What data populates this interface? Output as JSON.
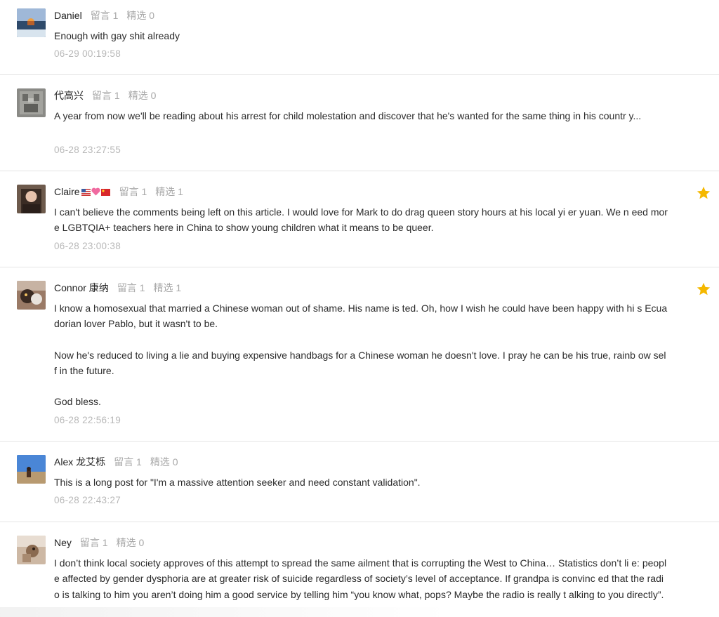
{
  "comments": [
    {
      "author": "Daniel",
      "author_flags": [],
      "reply_label": "留言 1",
      "featured_label": "精选 0",
      "paragraphs": [
        "Enough with gay shit already"
      ],
      "time": "06-29 00:19:58",
      "starred": false,
      "avatar_icon": "sea-sunset-avatar-icon"
    },
    {
      "author": "代高兴",
      "author_flags": [],
      "reply_label": "留言 1",
      "featured_label": "精选 0",
      "paragraphs": [
        "A year from now we'll be reading about his arrest for child molestation and discover that he's wanted for the same thing in his countr y..."
      ],
      "time": "06-28 23:27:55",
      "starred": false,
      "avatar_icon": "stone-carving-avatar-icon"
    },
    {
      "author": "Claire",
      "author_flags": [
        "us-flag-icon",
        "heart-icon",
        "china-flag-icon"
      ],
      "reply_label": "留言 1",
      "featured_label": "精选 1",
      "paragraphs": [
        "I can't believe the comments being left on this article. I would love for Mark to do drag queen story hours at his local yi er yuan. We n eed more LGBTQIA+ teachers here in China to show young children what it means to be queer."
      ],
      "time": "06-28 23:00:38",
      "starred": true,
      "avatar_icon": "portrait-avatar-icon"
    },
    {
      "author": "Connor 康纳",
      "author_flags": [],
      "reply_label": "留言 1",
      "featured_label": "精选 1",
      "paragraphs": [
        "I know a homosexual that married a Chinese woman out of shame. His name is ted. Oh, how I wish he could have been happy with hi s Ecuadorian lover Pablo, but it wasn't to be.",
        "Now he's reduced to living a lie and buying expensive handbags for a Chinese woman he doesn't love. I pray he can be his true, rainb ow self in the future.",
        "God bless."
      ],
      "time": "06-28 22:56:19",
      "starred": true,
      "avatar_icon": "cat-avatar-icon"
    },
    {
      "author": "Alex 龙艾栎",
      "author_flags": [],
      "reply_label": "留言 1",
      "featured_label": "精选 0",
      "paragraphs": [
        "This is a long post for \"I'm a massive attention seeker and need constant validation\"."
      ],
      "time": "06-28 22:43:27",
      "starred": false,
      "avatar_icon": "desert-sky-avatar-icon"
    },
    {
      "author": "Ney",
      "author_flags": [],
      "reply_label": "留言 1",
      "featured_label": "精选 0",
      "paragraphs": [
        "I don’t think local society approves of this attempt to spread the same ailment that is corrupting the West to China… Statistics don’t li e: people affected by gender dysphoria are at greater risk of suicide regardless of society’s level of acceptance. If grandpa is convinc ed that the radio is talking to him you aren’t doing him a good service by telling him “you know what, pops? Maybe the radio is really t alking to you directly”."
      ],
      "time": "",
      "starred": false,
      "avatar_icon": "animal-photo-avatar-icon"
    }
  ],
  "colors": {
    "accent_star": "#f5b800",
    "meta_gray": "#a8a8a8",
    "time_gray": "#b8b8b8",
    "divider": "#e4e4e4"
  }
}
